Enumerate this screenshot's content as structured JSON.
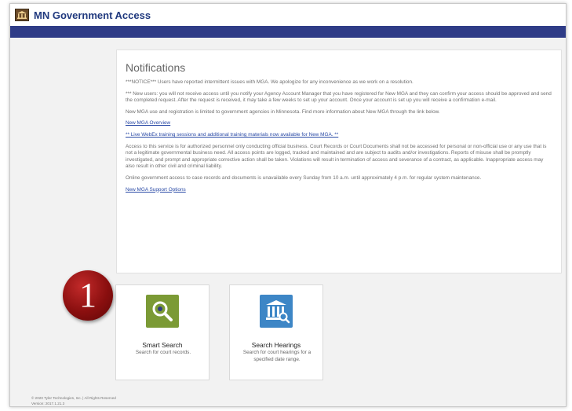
{
  "header": {
    "title": "MN Government Access"
  },
  "notifications": {
    "title": "Notifications",
    "messages": [
      "***NOTICE*** Users have reported intermittent issues with MGA. We apologize for any inconvenience as we work on a resolution.",
      "*** New users: you will not receive access until you notify your Agency Account Manager that you have registered for New MGA and they can confirm your access should be approved and send the completed request. After the request is received, it may take a few weeks to set up your account. Once your account is set up you will receive a confirmation e-mail.",
      "New MGA use and registration is limited to government agencies in Minnesota. Find more information about New MGA through the link below."
    ],
    "link_overview": "New MGA Overview",
    "link_training": "** Live WebEx training sessions and additional training materials now available for New MGA. **",
    "notice_access": "Access to this service is for authorized personnel only conducting official business. Court Records or Court Documents shall not be accessed for personal or non-official use or any use that is not a legitimate governmental business need. All access points are logged, tracked and maintained and are subject to audits and/or investigations. Reports of misuse shall be promptly investigated, and prompt and appropriate corrective action shall be taken. Violations will result in termination of access and severance of a contract, as applicable. Inappropriate access may also result in other civil and criminal liability.",
    "notice_maintenance": "Online government access to case records and documents is unavailable every Sunday from 10 a.m. until approximately 4 p.m. for regular system maintenance.",
    "link_support": "New MGA Support Options"
  },
  "callout": {
    "number": "1"
  },
  "tiles": [
    {
      "title": "Smart Search",
      "desc": "Search for court records.",
      "icon": "magnifier-icon",
      "color": "#7b9a35"
    },
    {
      "title": "Search Hearings",
      "desc": "Search for court hearings for a specified date range.",
      "icon": "courthouse-search-icon",
      "color": "#3d86c6"
    }
  ],
  "footer": {
    "copyright": "© 2020 Tyler Technologies, Inc. | All Rights Reserved",
    "version": "Version: 2017.1.21.3"
  }
}
